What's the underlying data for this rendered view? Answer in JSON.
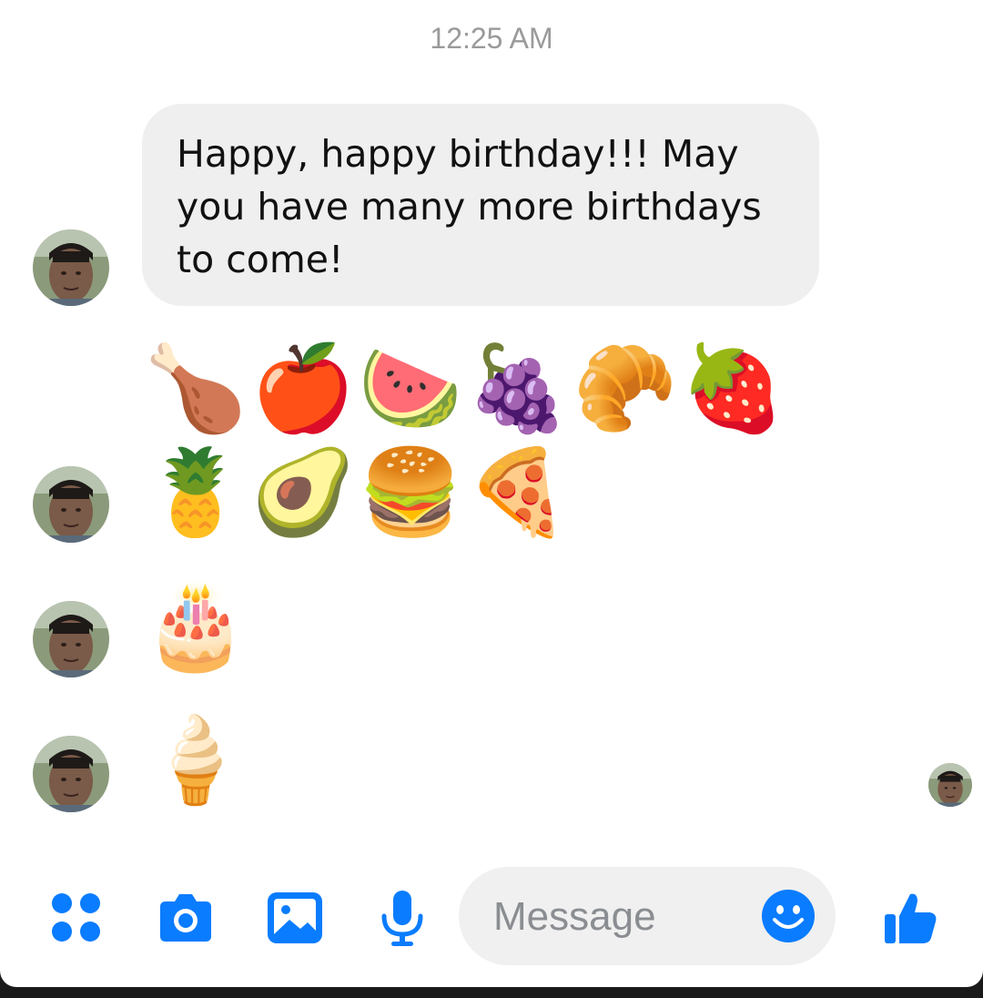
{
  "thread": {
    "timestamp": "12:25 AM",
    "messages": [
      {
        "type": "text",
        "text": "Happy, happy birthday!!! May you have many more birthdays to come!"
      }
    ],
    "emoji_rows": [
      {
        "items": [
          "🍗",
          "🍎",
          "🍉",
          "🍇",
          "🥐",
          "🍓"
        ]
      },
      {
        "items": [
          "🍍",
          "🥑",
          "🍔",
          "🍕"
        ]
      },
      {
        "items": [
          "🎂"
        ]
      },
      {
        "items": [
          "🍦"
        ]
      }
    ]
  },
  "composer": {
    "placeholder": "Message",
    "icons": [
      "apps-icon",
      "camera-icon",
      "gallery-icon",
      "microphone-icon",
      "emoji-icon",
      "thumbs-up-icon"
    ],
    "accent_color": "#0a7cff"
  }
}
